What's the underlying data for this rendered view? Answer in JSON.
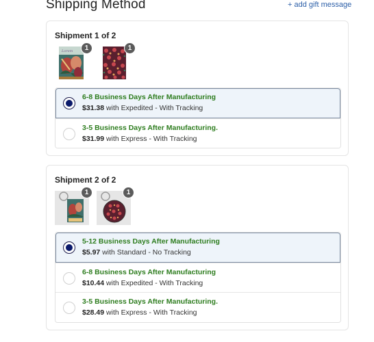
{
  "header": {
    "title": "Shipping Method",
    "gift_link": "+ add gift message"
  },
  "shipments": [
    {
      "title": "Shipment 1 of 2",
      "items": [
        {
          "type": "notebook-floral-tropical",
          "qty": "1"
        },
        {
          "type": "notebook-floral-pattern",
          "qty": "1"
        }
      ],
      "options": [
        {
          "title": "6-8 Business Days After Manufacturing",
          "price": "$31.38",
          "method": " with Expedited - With Tracking",
          "selected": true
        },
        {
          "title": "3-5 Business Days After Manufacturing.",
          "price": "$31.99",
          "method": " with Express - With Tracking",
          "selected": false
        }
      ]
    },
    {
      "title": "Shipment 2 of 2",
      "items": [
        {
          "type": "keychain-rectangle",
          "qty": "1"
        },
        {
          "type": "keychain-round",
          "qty": "1"
        }
      ],
      "options": [
        {
          "title": "5-12 Business Days After Manufacturing",
          "price": "$5.97",
          "method": " with Standard - No Tracking",
          "selected": true
        },
        {
          "title": "6-8 Business Days After Manufacturing",
          "price": "$10.44",
          "method": " with Expedited - With Tracking",
          "selected": false
        },
        {
          "title": "3-5 Business Days After Manufacturing.",
          "price": "$28.49",
          "method": " with Express - With Tracking",
          "selected": false
        }
      ]
    }
  ],
  "colors": {
    "accent_green": "#2e7d1f",
    "radio_selected": "#0b1a6b",
    "selected_bg": "#eef4fa",
    "link": "#2c5fa8",
    "badge": "#5b5b5b"
  }
}
